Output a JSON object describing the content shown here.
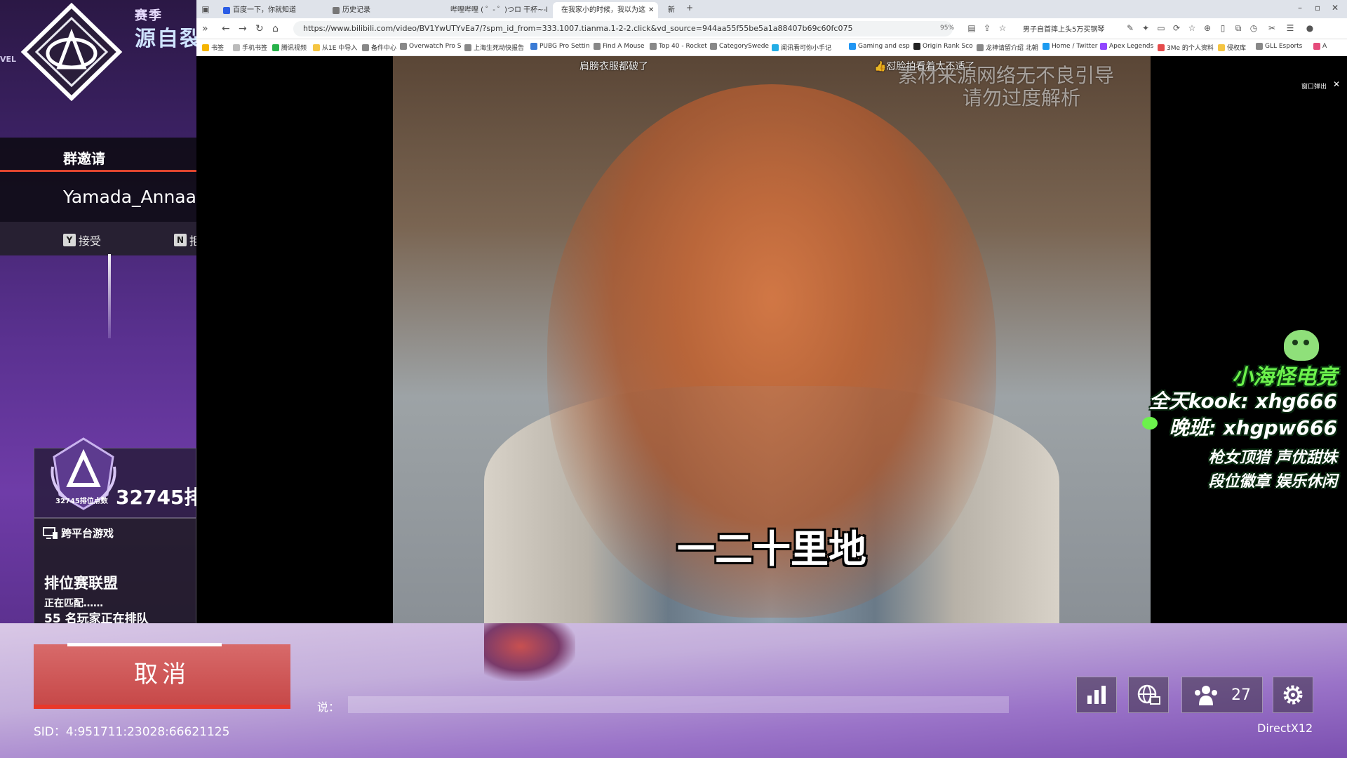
{
  "game": {
    "season_label": "赛季",
    "season_name": "源自裂",
    "level_tag": "VEL",
    "invite": {
      "title": "群邀请",
      "player": "Yamada_Annaaa",
      "accept_key": "Y",
      "accept_label": "接受",
      "decline_key": "N",
      "decline_label": "拒"
    },
    "rank": {
      "badge_text": "32745排位点数",
      "points": "32745排"
    },
    "mode": {
      "crossplay_label": "跨平台游戏",
      "title": "排位赛联盟",
      "matching": "正在匹配……",
      "queue": "55 名玩家正在排队"
    },
    "cancel_label": "取消",
    "chat_label": "说：",
    "sid": "SID：4:951711:23028:66621125",
    "squad_count": "27",
    "api": "DirectX12"
  },
  "browser": {
    "tabs": [
      {
        "label": "百度一下，你就知道",
        "active": false
      },
      {
        "label": "历史记录",
        "active": false
      },
      {
        "label": "哔哩哔哩 ( ゜- ゜)つロ 干杯~-bili",
        "active": false
      },
      {
        "label": "在我家小的时候，我以为这",
        "active": true
      },
      {
        "label": "新",
        "active": false
      }
    ],
    "url": "https://www.bilibili.com/video/BV1YwUTYvEa7/?spm_id_from=333.1007.tianma.1-2-2.click&vd_source=944aa55f55be5a1a88407b69c60fc075",
    "zoom": "95%",
    "extension_text": "男子自首摔上头5万买钢琴",
    "bookmarks": [
      "书签",
      "手机书签",
      "腾讯视频",
      "从1E 中导入",
      "备件中心",
      "Overwatch Pro S",
      "上海生死动快报告",
      "PUBG Pro Settin",
      "Find A Mouse",
      "Top 40 - Rocket",
      "CategorySwede",
      "闻讯看可你小手记",
      "Gaming and esp",
      "Origin Rank Sco",
      "龙神请留介绍 北朝",
      "Home / Twitter",
      "Apex Legends",
      "3Me 的个人资料",
      "侵权库",
      "GLL Esports",
      "A"
    ],
    "popout_label": "窗口弹出",
    "video": {
      "danmaku_1": "肩膀衣服都破了",
      "danmaku_2": "👍怼脸拍看着太不适了",
      "disclaimer_1": "素材来源网络无不良引导",
      "disclaimer_2": "请勿过度解析",
      "subtitle": "一二十里地"
    }
  },
  "overlay": {
    "brand": "小海怪电竞",
    "kook": "全天kook: xhg666",
    "night": "晚班: xhgpw666",
    "tag1": "枪女顶猎 声优甜妹",
    "tag2": "段位徽章 娱乐休闲"
  },
  "colors": {
    "accent_red": "#e0452f",
    "cancel_bg": "#c64747",
    "overlay_green": "#6cf24c"
  }
}
